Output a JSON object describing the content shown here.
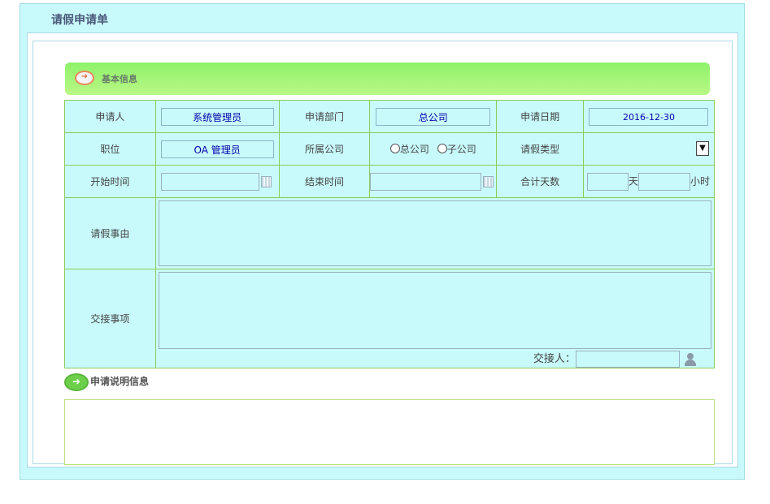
{
  "page": {
    "title": "请假申请单"
  },
  "basic_section": {
    "label": "基本信息"
  },
  "fields": {
    "applicant_label": "申请人",
    "applicant_value": "系统管理员",
    "dept_label": "申请部门",
    "dept_value": "总公司",
    "date_label": "申请日期",
    "date_value": "2016-12-30",
    "position_label": "职位",
    "position_value": "OA 管理员",
    "company_label": "所属公司",
    "company_options": [
      "总公司",
      "子公司"
    ],
    "leave_type_label": "请假类型",
    "start_label": "开始时间",
    "end_label": "结束时间",
    "total_label": "合计天数",
    "day_unit": "天",
    "hour_unit": "小时",
    "reason_label": "请假事由",
    "handover_label": "交接事项",
    "handover_person_label": "交接人："
  },
  "application_section": {
    "label": "申请说明信息"
  },
  "colors": {
    "panel_bg": "#c9fafb",
    "border_green": "#8ccb5c",
    "bar_green": "#8ef26a"
  }
}
